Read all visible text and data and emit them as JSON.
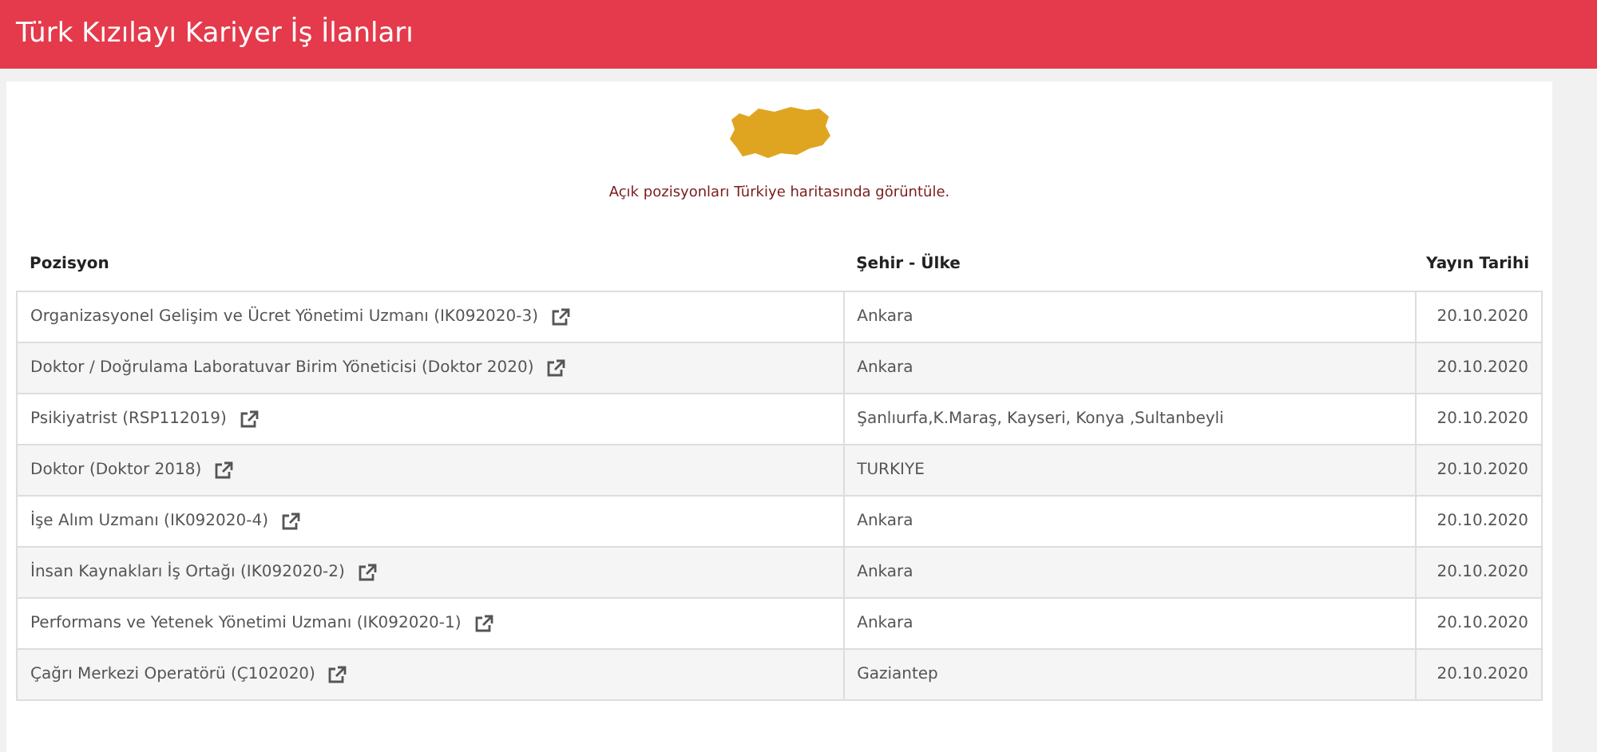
{
  "header": {
    "title": "Türk Kızılayı Kariyer İş İlanları"
  },
  "map_caption": "Açık pozisyonları Türkiye haritasında görüntüle.",
  "table": {
    "columns": [
      "Pozisyon",
      "Şehir - Ülke",
      "Yayın Tarihi"
    ],
    "rows": [
      {
        "position": "Organizasyonel Gelişim ve Ücret Yönetimi Uzmanı (IK092020-3)",
        "city": "Ankara",
        "date": "20.10.2020"
      },
      {
        "position": "Doktor / Doğrulama Laboratuvar Birim Yöneticisi (Doktor 2020)",
        "city": "Ankara",
        "date": "20.10.2020"
      },
      {
        "position": "Psikiyatrist (RSP112019)",
        "city": "Şanlıurfa,K.Maraş, Kayseri, Konya ,Sultanbeyli",
        "date": "20.10.2020"
      },
      {
        "position": "Doktor (Doktor 2018)",
        "city": "TURKIYE",
        "date": "20.10.2020"
      },
      {
        "position": "İşe Alım Uzmanı (IK092020-4)",
        "city": "Ankara",
        "date": "20.10.2020"
      },
      {
        "position": "İnsan Kaynakları İş Ortağı (IK092020-2)",
        "city": "Ankara",
        "date": "20.10.2020"
      },
      {
        "position": "Performans ve Yetenek Yönetimi Uzmanı (IK092020-1)",
        "city": "Ankara",
        "date": "20.10.2020"
      },
      {
        "position": "Çağrı Merkezi Operatörü (Ç102020)",
        "city": "Gaziantep",
        "date": "20.10.2020"
      }
    ]
  }
}
